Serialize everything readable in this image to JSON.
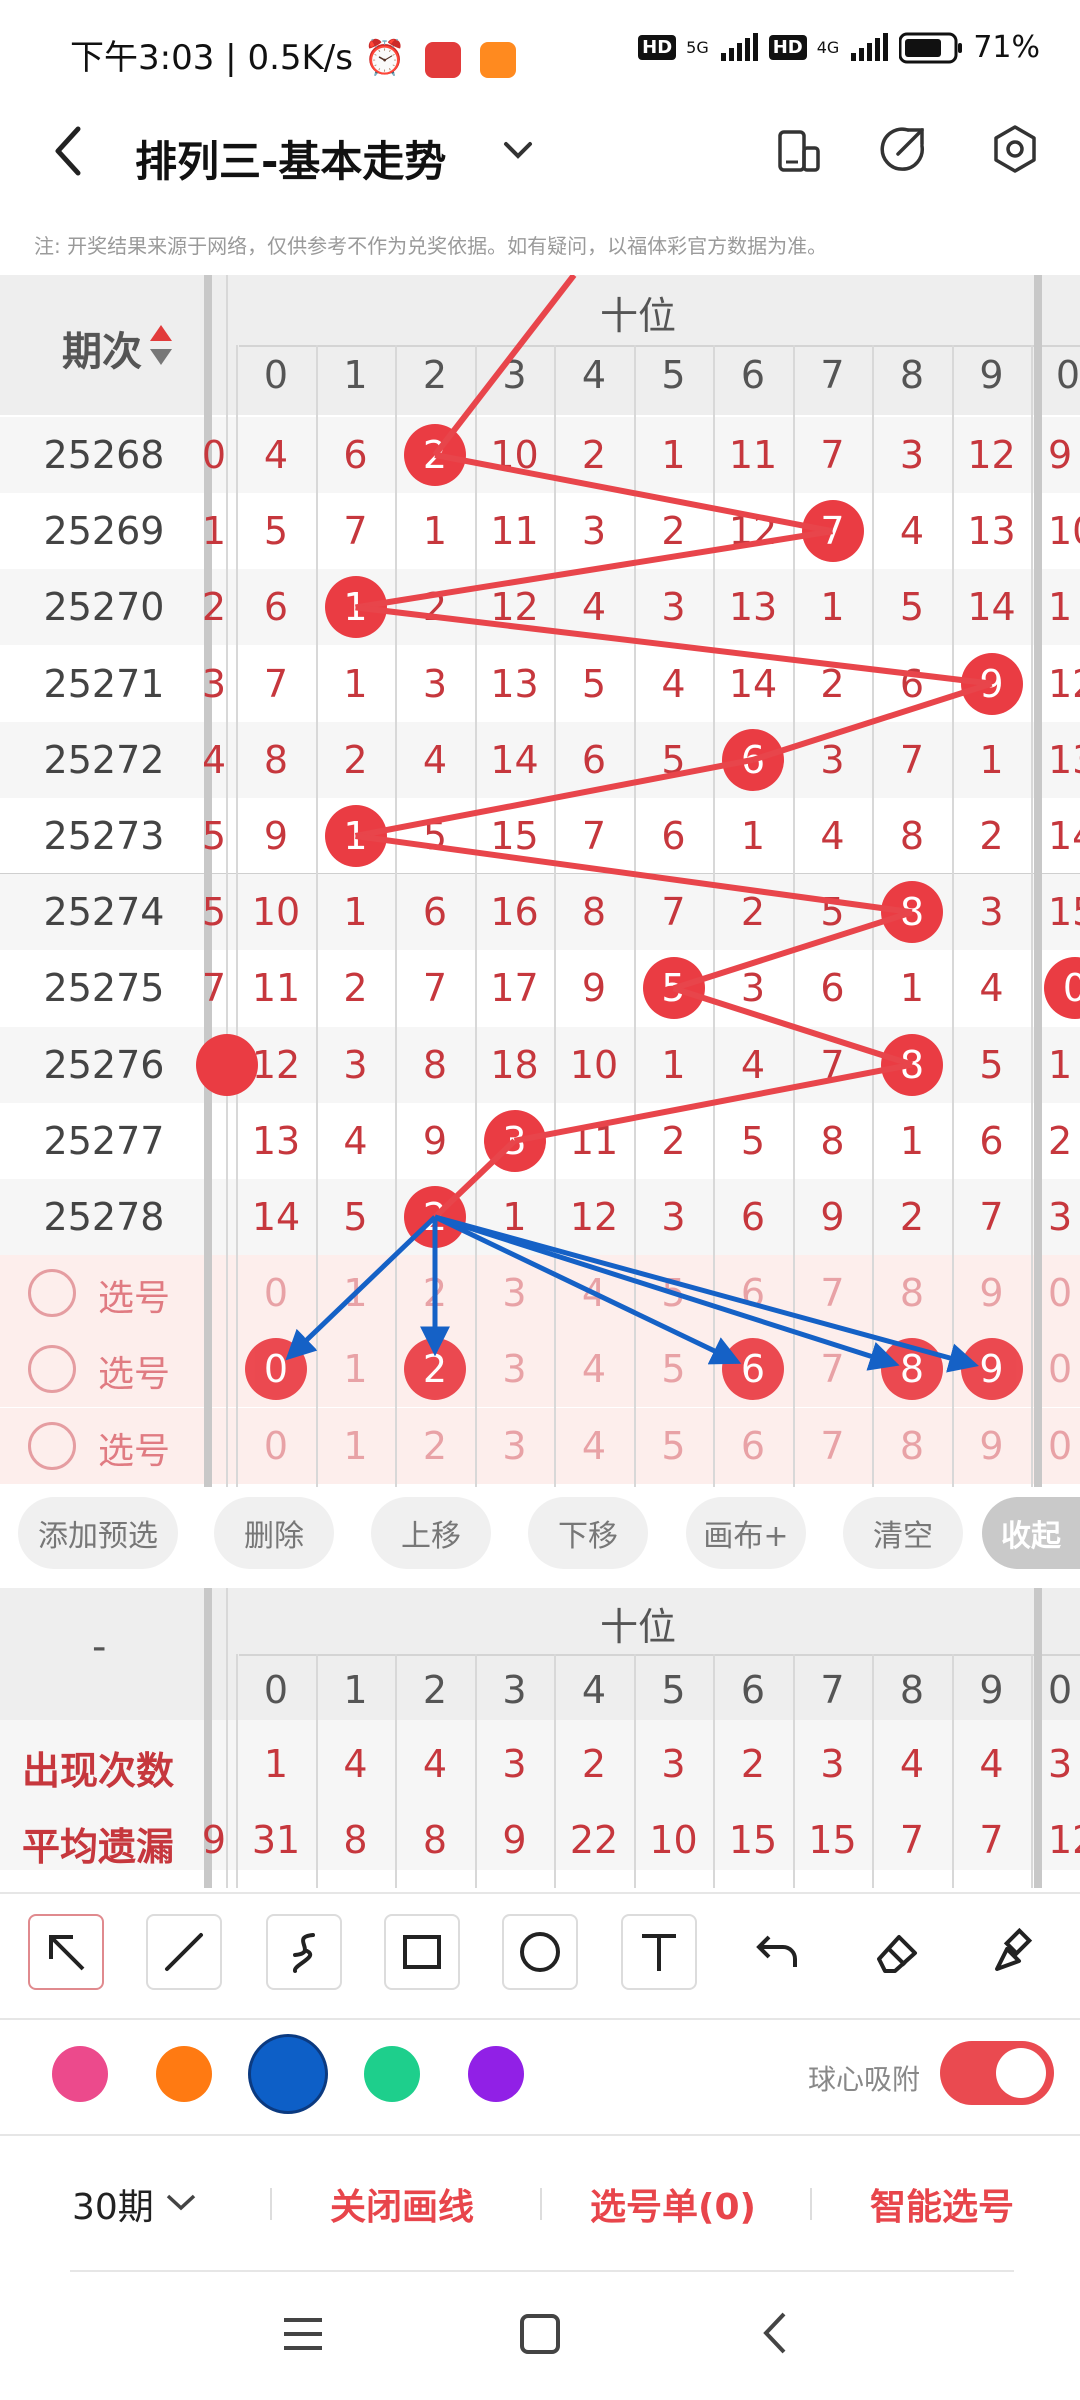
{
  "status_bar": {
    "time": "下午3:03",
    "speed": "0.5K/s",
    "hd1": "HD",
    "net1": "5G",
    "hd2": "HD",
    "net2": "4G",
    "battery": "71%"
  },
  "header": {
    "title": "排列三-基本走势",
    "notice": "注: 开奖结果来源于网络，仅供参考不作为兑奖依据。如有疑问，以福体彩官方数据为准。"
  },
  "table": {
    "period_header": "期次",
    "group_header": "十位",
    "digits": [
      "0",
      "1",
      "2",
      "3",
      "4",
      "5",
      "6",
      "7",
      "8",
      "9"
    ],
    "next_col_header": "0",
    "rows": [
      {
        "period": "25268",
        "left_partial": "0",
        "cells": [
          "4",
          "6",
          "2",
          "10",
          "2",
          "1",
          "11",
          "7",
          "3",
          "12"
        ],
        "ball": 2,
        "right_partial": "9"
      },
      {
        "period": "25269",
        "left_partial": "1",
        "cells": [
          "5",
          "7",
          "1",
          "11",
          "3",
          "2",
          "12",
          "7",
          "4",
          "13"
        ],
        "ball": 7,
        "right_partial": "10"
      },
      {
        "period": "25270",
        "left_partial": "2",
        "cells": [
          "6",
          "1",
          "2",
          "12",
          "4",
          "3",
          "13",
          "1",
          "5",
          "14"
        ],
        "ball": 1,
        "right_partial": "1"
      },
      {
        "period": "25271",
        "left_partial": "3",
        "cells": [
          "7",
          "1",
          "3",
          "13",
          "5",
          "4",
          "14",
          "2",
          "6",
          "9"
        ],
        "ball": 9,
        "right_partial": "12"
      },
      {
        "period": "25272",
        "left_partial": "4",
        "cells": [
          "8",
          "2",
          "4",
          "14",
          "6",
          "5",
          "6",
          "3",
          "7",
          "1"
        ],
        "ball": 6,
        "right_partial": "13"
      },
      {
        "period": "25273",
        "left_partial": "5",
        "cells": [
          "9",
          "1",
          "5",
          "15",
          "7",
          "6",
          "1",
          "4",
          "8",
          "2"
        ],
        "ball": 1,
        "right_partial": "14"
      },
      {
        "period": "25274",
        "left_partial": "5",
        "cells": [
          "10",
          "1",
          "6",
          "16",
          "8",
          "7",
          "2",
          "5",
          "8",
          "3"
        ],
        "ball": 8,
        "right_partial": "15"
      },
      {
        "period": "25275",
        "left_partial": "7",
        "cells": [
          "11",
          "2",
          "7",
          "17",
          "9",
          "5",
          "3",
          "6",
          "1",
          "4"
        ],
        "ball": 5,
        "right_partial": "0"
      },
      {
        "period": "25276",
        "left_partial": "",
        "cells": [
          "12",
          "3",
          "8",
          "18",
          "10",
          "1",
          "4",
          "7",
          "8",
          "5"
        ],
        "ball": 8,
        "right_partial": "1"
      },
      {
        "period": "25277",
        "left_partial": "",
        "cells": [
          "13",
          "4",
          "9",
          "3",
          "11",
          "2",
          "5",
          "8",
          "1",
          "6"
        ],
        "ball": 3,
        "right_partial": "2"
      },
      {
        "period": "25278",
        "left_partial": "",
        "cells": [
          "14",
          "5",
          "2",
          "1",
          "12",
          "3",
          "6",
          "9",
          "2",
          "7"
        ],
        "ball": 2,
        "right_partial": "3"
      }
    ],
    "pick_label": "选号",
    "pick_rows": [
      {
        "cells": [
          "0",
          "1",
          "2",
          "3",
          "4",
          "5",
          "6",
          "7",
          "8",
          "9"
        ],
        "selected": [],
        "right_partial": "0"
      },
      {
        "cells": [
          "0",
          "1",
          "2",
          "3",
          "4",
          "5",
          "6",
          "7",
          "8",
          "9"
        ],
        "selected": [
          0,
          2,
          6,
          8,
          9
        ],
        "right_partial": "0"
      },
      {
        "cells": [
          "0",
          "1",
          "2",
          "3",
          "4",
          "5",
          "6",
          "7",
          "8",
          "9"
        ],
        "selected": [],
        "right_partial": "0"
      }
    ]
  },
  "actions": {
    "add_preselect": "添加预选",
    "delete": "删除",
    "move_up": "上移",
    "move_down": "下移",
    "canvas_plus": "画布+",
    "clear": "清空",
    "collapse": "收起"
  },
  "stats": {
    "corner": "-",
    "group_header": "十位",
    "occurrences_label": "出现次数",
    "occurrences": [
      "1",
      "4",
      "4",
      "3",
      "2",
      "3",
      "2",
      "3",
      "4",
      "4"
    ],
    "occurrences_next": "3",
    "avg_miss_label": "平均遗漏",
    "avg_miss": [
      "31",
      "8",
      "8",
      "9",
      "22",
      "10",
      "15",
      "15",
      "7",
      "7"
    ],
    "avg_miss_next": "12",
    "avg_miss_left_partial": "9"
  },
  "drawing": {
    "tools": [
      "arrow-tool",
      "line-tool",
      "curve-tool",
      "rect-tool",
      "circle-tool",
      "text-tool",
      "undo-tool",
      "eraser-tool",
      "clear-brush-tool"
    ],
    "colors": [
      "#ec4a8c",
      "#ff7a12",
      "#0d5fc7",
      "#1ecf8c",
      "#9120e6"
    ],
    "selected_color": "#0d5fc7",
    "snap_label": "球心吸附",
    "snap_on": true
  },
  "bottom_bar": {
    "periods": "30期",
    "close_lines": "关闭画线",
    "pick_list": "选号单(0)",
    "smart_pick": "智能选号"
  },
  "colors": {
    "accent_red": "#ea3c43",
    "arrow_blue": "#1561c6",
    "trend_line": "#e8454b"
  }
}
